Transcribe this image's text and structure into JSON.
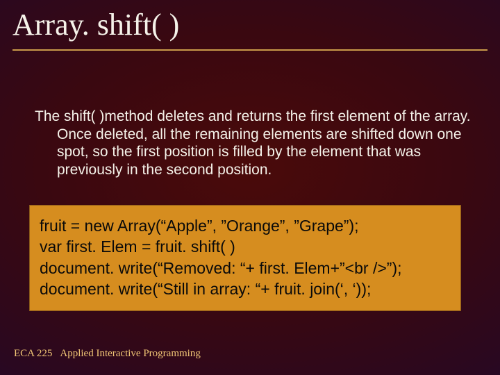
{
  "title": "Array. shift( )",
  "paragraph": "The shift( )method deletes and returns the first element of the array. Once deleted, all the remaining elements are shifted down one spot, so the first position is filled by the element that was previously in the second position.",
  "code": {
    "line1": "fruit = new Array(“Apple”, ”Orange”, ”Grape”);",
    "line2": "var first. Elem = fruit. shift( )",
    "line3": "document. write(“Removed: “+ first. Elem+”<br />”);",
    "line4": "document. write(“Still in array: “+ fruit. join(‘, ‘));"
  },
  "footer": {
    "course": "ECA 225",
    "name": "Applied Interactive Programming"
  }
}
